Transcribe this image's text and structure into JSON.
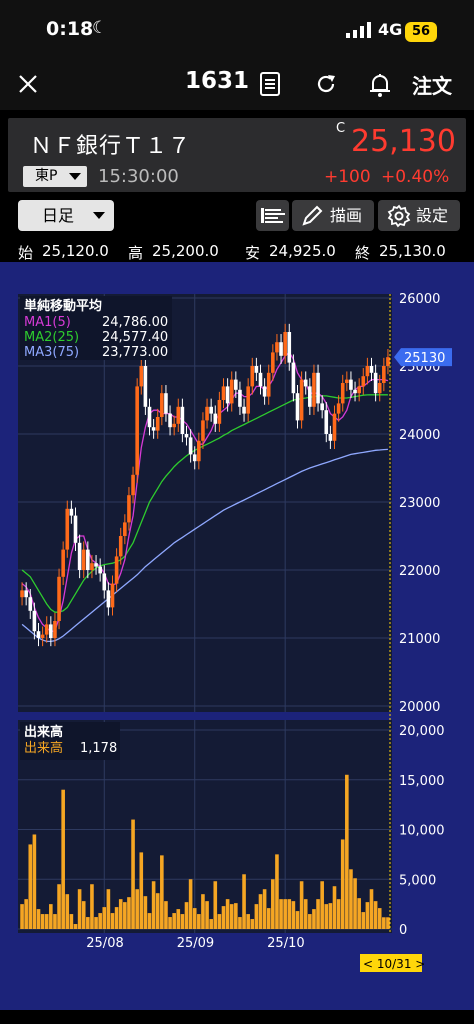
{
  "status_bar": {
    "time": "0:18",
    "network": "4G",
    "battery": "56"
  },
  "nav": {
    "code": "1631",
    "order_label": "注文"
  },
  "header": {
    "name": "ＮＦ銀行Ｔ１７",
    "market": "東P",
    "time": "15:30:00",
    "flag": "C",
    "price": "25,130",
    "change": "+100",
    "change_pct": "+0.40%"
  },
  "toolbar": {
    "period": "日足",
    "draw_label": "描画",
    "setting_label": "設定"
  },
  "ohlc": {
    "open_label": "始",
    "open": "25,120.0",
    "high_label": "高",
    "high": "25,200.0",
    "low_label": "安",
    "low": "24,925.0",
    "close_label": "終",
    "close": "25,130.0"
  },
  "colors": {
    "up": "#ff6a1a",
    "down": "#ffffff",
    "ma1": "#d63ad6",
    "ma2": "#2ecc2e",
    "ma3": "#8fa8ff",
    "volume": "#f5a623",
    "price_tag": "#3b6cf0",
    "panel": "#141b35"
  },
  "chart_data": [
    {
      "type": "candlestick",
      "title": "単純移動平均",
      "ylim": [
        20000,
        26000
      ],
      "y_ticks": [
        "26000",
        "25000",
        "24000",
        "23000",
        "22000",
        "21000",
        "20000"
      ],
      "last_price_tag": "25130",
      "series": [
        {
          "name": "MA1(5)",
          "value": "24,786.00"
        },
        {
          "name": "MA2(25)",
          "value": "24,577.40"
        },
        {
          "name": "MA3(75)",
          "value": "23,773.00"
        }
      ],
      "closes": [
        21700,
        21600,
        21400,
        21100,
        21000,
        21050,
        21200,
        21000,
        21250,
        21900,
        22300,
        22900,
        22800,
        22400,
        22000,
        22300,
        22000,
        22100,
        22050,
        21950,
        21700,
        21450,
        21800,
        22200,
        22500,
        22700,
        23100,
        23400,
        24700,
        25000,
        24400,
        24100,
        24050,
        24250,
        24600,
        24300,
        24100,
        24150,
        24400,
        24000,
        23950,
        23700,
        23600,
        23900,
        24200,
        24400,
        24300,
        24150,
        24500,
        24700,
        24450,
        24800,
        24650,
        24400,
        24300,
        24700,
        25000,
        24900,
        24700,
        24550,
        24900,
        25200,
        25350,
        25150,
        25500,
        25050,
        24600,
        24200,
        24800,
        24700,
        24400,
        24900,
        24450,
        24350,
        24000,
        23900,
        24300,
        24450,
        24750,
        24800,
        24650,
        24600,
        24700,
        24850,
        25000,
        24900,
        24600,
        24750,
        25000,
        25130
      ],
      "ma5": [
        21800,
        21750,
        21650,
        21450,
        21300,
        21200,
        21150,
        21100,
        21100,
        21300,
        21550,
        21900,
        22250,
        22450,
        22500,
        22500,
        22300,
        22150,
        22100,
        22050,
        21950,
        21800,
        21780,
        21800,
        21950,
        22150,
        22500,
        22800,
        23300,
        23800,
        24100,
        24300,
        24350,
        24350,
        24300,
        24300,
        24300,
        24250,
        24250,
        24200,
        24150,
        24050,
        23950,
        23850,
        23850,
        23950,
        24050,
        24200,
        24300,
        24350,
        24400,
        24500,
        24600,
        24600,
        24550,
        24550,
        24600,
        24700,
        24700,
        24650,
        24700,
        24800,
        24950,
        25050,
        25150,
        25200,
        25100,
        24900,
        24800,
        24750,
        24600,
        24600,
        24600,
        24550,
        24450,
        24300,
        24250,
        24200,
        24250,
        24350,
        24550,
        24650,
        24700,
        24700,
        24750,
        24800,
        24800,
        24800,
        24800,
        24786
      ],
      "ma25": [
        22000,
        21950,
        21900,
        21800,
        21700,
        21600,
        21500,
        21420,
        21380,
        21380,
        21400,
        21450,
        21550,
        21650,
        21750,
        21850,
        21920,
        21980,
        22030,
        22060,
        22080,
        22090,
        22100,
        22120,
        22150,
        22200,
        22300,
        22400,
        22550,
        22700,
        22850,
        23000,
        23100,
        23200,
        23300,
        23380,
        23450,
        23520,
        23580,
        23630,
        23680,
        23720,
        23760,
        23790,
        23820,
        23850,
        23880,
        23910,
        23940,
        23980,
        24010,
        24050,
        24080,
        24110,
        24140,
        24170,
        24200,
        24230,
        24260,
        24290,
        24320,
        24350,
        24380,
        24410,
        24440,
        24470,
        24500,
        24510,
        24520,
        24530,
        24540,
        24550,
        24560,
        24560,
        24560,
        24550,
        24540,
        24530,
        24530,
        24530,
        24540,
        24550,
        24560,
        24570,
        24575,
        24577,
        24577,
        24577,
        24577,
        24577
      ],
      "ma75": [
        21200,
        21150,
        21100,
        21050,
        21000,
        20970,
        20950,
        20950,
        20960,
        20990,
        21030,
        21080,
        21130,
        21180,
        21230,
        21280,
        21330,
        21380,
        21430,
        21480,
        21530,
        21580,
        21630,
        21680,
        21730,
        21780,
        21830,
        21880,
        21930,
        21990,
        22050,
        22100,
        22150,
        22200,
        22250,
        22300,
        22350,
        22400,
        22440,
        22480,
        22520,
        22560,
        22600,
        22640,
        22680,
        22720,
        22760,
        22800,
        22840,
        22880,
        22910,
        22940,
        22970,
        23000,
        23030,
        23060,
        23090,
        23120,
        23150,
        23180,
        23210,
        23240,
        23270,
        23300,
        23330,
        23360,
        23390,
        23420,
        23450,
        23475,
        23500,
        23520,
        23540,
        23560,
        23580,
        23600,
        23620,
        23640,
        23660,
        23680,
        23700,
        23710,
        23720,
        23730,
        23740,
        23750,
        23760,
        23765,
        23770,
        23773
      ]
    },
    {
      "type": "bar",
      "title": "出来高",
      "series": [
        {
          "name": "出来高",
          "value": "1,178"
        }
      ],
      "ylim": [
        0,
        20000
      ],
      "y_ticks": [
        "20,000",
        "15,000",
        "10,000",
        "5,000",
        "0"
      ],
      "x_labels": [
        "25/08",
        "25/09",
        "25/10"
      ],
      "current_label": "< 10/31 >",
      "values": [
        2500,
        3000,
        8500,
        9500,
        2000,
        1500,
        1500,
        2500,
        1500,
        4500,
        14000,
        3500,
        1500,
        500,
        4000,
        2800,
        1200,
        4500,
        1200,
        1600,
        2200,
        4000,
        1600,
        2200,
        3000,
        2700,
        3200,
        11000,
        4000,
        7700,
        3300,
        1600,
        4800,
        3600,
        7400,
        2800,
        1200,
        1600,
        2000,
        1500,
        2700,
        5000,
        2100,
        1500,
        3500,
        2800,
        1000,
        4800,
        1500,
        2300,
        3000,
        2500,
        2600,
        1200,
        5500,
        1500,
        1000,
        2500,
        3500,
        4000,
        2100,
        5000,
        7500,
        3000,
        3000,
        3000,
        2800,
        1800,
        4800,
        3000,
        1500,
        2000,
        3000,
        4800,
        2500,
        2600,
        4300,
        3000,
        9000,
        15500,
        6000,
        5100,
        3100,
        1700,
        2700,
        4000,
        2800,
        2100,
        1178,
        1178
      ],
      "axis_end_labels": [
        "0"
      ]
    }
  ]
}
